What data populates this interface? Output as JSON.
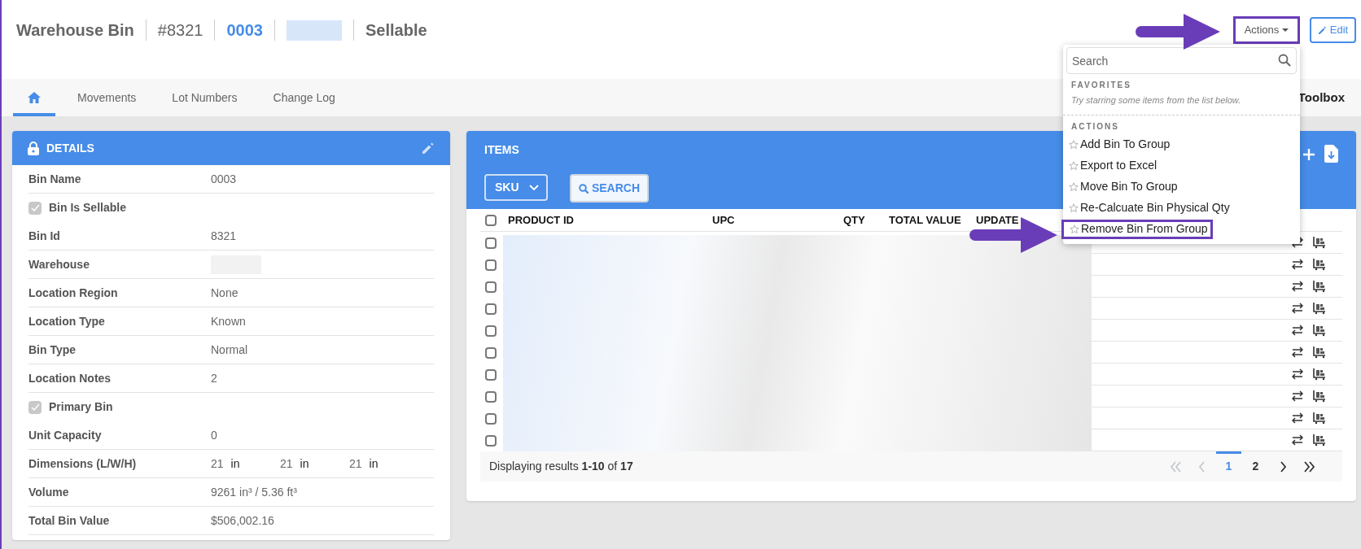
{
  "header": {
    "title": "Warehouse Bin",
    "bin_id": "#8321",
    "bin_name": "0003",
    "status": "Sellable"
  },
  "actions_button": "Actions",
  "edit_button": "Edit",
  "tabs": [
    {
      "kind": "home",
      "selected": true
    },
    {
      "kind": "text",
      "label": "Movements",
      "selected": false
    },
    {
      "kind": "text",
      "label": "Lot Numbers",
      "selected": false
    },
    {
      "kind": "text",
      "label": "Change Log",
      "selected": false
    }
  ],
  "toolbox": "Toolbox",
  "actions_menu": {
    "search_placeholder": "Search",
    "favorites_heading": "FAVORITES",
    "favorites_hint": "Try starring some items from the list below.",
    "actions_heading": "ACTIONS",
    "items": [
      {
        "label": "Add Bin To Group",
        "highlighted": false
      },
      {
        "label": "Export to Excel",
        "highlighted": false
      },
      {
        "label": "Move Bin To Group",
        "highlighted": false
      },
      {
        "label": "Re-Calcuate Bin Physical Qty",
        "highlighted": false
      },
      {
        "label": "Remove Bin From Group",
        "highlighted": true
      }
    ]
  },
  "details": {
    "title": "DETAILS",
    "rows": [
      {
        "kind": "field",
        "label": "Bin Name",
        "value": "0003"
      },
      {
        "kind": "checkbox",
        "label": "Bin Is Sellable",
        "checked": true
      },
      {
        "kind": "field",
        "label": "Bin Id",
        "value": "8321"
      },
      {
        "kind": "redacted",
        "label": "Warehouse"
      },
      {
        "kind": "field",
        "label": "Location Region",
        "value": "None"
      },
      {
        "kind": "field",
        "label": "Location Type",
        "value": "Known"
      },
      {
        "kind": "field",
        "label": "Bin Type",
        "value": "Normal"
      },
      {
        "kind": "field",
        "label": "Location Notes",
        "value": "2"
      },
      {
        "kind": "checkbox",
        "label": "Primary Bin",
        "checked": true
      },
      {
        "kind": "field",
        "label": "Unit Capacity",
        "value": "0"
      },
      {
        "kind": "dimensions",
        "label": "Dimensions (L/W/H)",
        "values": [
          {
            "value": "21",
            "unit": "in"
          },
          {
            "value": "21",
            "unit": "in"
          },
          {
            "value": "21",
            "unit": "in"
          }
        ]
      },
      {
        "kind": "field",
        "label": "Volume",
        "value": "9261 in³ / 5.36 ft³"
      },
      {
        "kind": "field",
        "label": "Total Bin Value",
        "value": "$506,002.16"
      }
    ]
  },
  "items": {
    "title": "ITEMS",
    "filter": "SKU",
    "search_button": "SEARCH",
    "select_all_checked": false,
    "columns": [
      "PRODUCT ID",
      "UPC",
      "QTY",
      "TOTAL VALUE",
      "UPDATE"
    ],
    "rows": [
      {
        "checked": false
      },
      {
        "checked": false
      },
      {
        "checked": false
      },
      {
        "checked": false
      },
      {
        "checked": false
      },
      {
        "checked": false
      },
      {
        "checked": false
      },
      {
        "checked": false
      },
      {
        "checked": false
      },
      {
        "checked": false
      }
    ],
    "footer": "Displaying results **1-10** of **17**",
    "pagination": [
      {
        "kind": "first",
        "disabled": true
      },
      {
        "kind": "prev",
        "disabled": true
      },
      {
        "kind": "page",
        "label": "1",
        "selected": true
      },
      {
        "kind": "page",
        "label": "2",
        "selected": false
      },
      {
        "kind": "next",
        "disabled": false
      },
      {
        "kind": "last",
        "disabled": false
      }
    ]
  }
}
